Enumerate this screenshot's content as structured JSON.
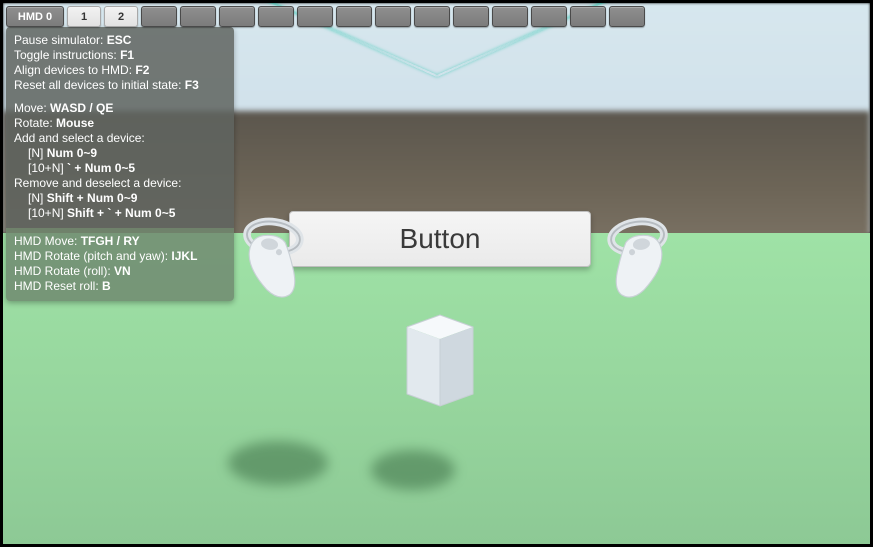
{
  "topbar": {
    "hmd_label": "HMD 0",
    "active_devices": [
      "1",
      "2"
    ],
    "blank_count": 13
  },
  "world_button_label": "Button",
  "instructions": {
    "group1": [
      {
        "label": "Pause simulator:",
        "key": "ESC"
      },
      {
        "label": "Toggle instructions:",
        "key": "F1"
      },
      {
        "label": "Align devices to HMD:",
        "key": "F2"
      },
      {
        "label": "Reset all devices to initial state:",
        "key": "F3"
      }
    ],
    "group2": {
      "move": {
        "label": "Move:",
        "key": "WASD / QE"
      },
      "rotate": {
        "label": "Rotate:",
        "key": "Mouse"
      },
      "add_header": "Add and select a device:",
      "add_n": {
        "prefix": "[N]",
        "key": "Num 0~9"
      },
      "add_10n": {
        "prefix": "[10+N]",
        "key": "` + Num 0~5"
      },
      "remove_header": "Remove and deselect a device:",
      "rem_n": {
        "prefix": "[N]",
        "key": "Shift + Num 0~9"
      },
      "rem_10n": {
        "prefix": "[10+N]",
        "key": "Shift + ` + Num 0~5"
      }
    },
    "group3": [
      {
        "label": "HMD Move:",
        "key": "TFGH / RY"
      },
      {
        "label": "HMD Rotate (pitch and yaw):",
        "key": "IJKL"
      },
      {
        "label": "HMD Rotate (roll):",
        "key": "VN"
      },
      {
        "label": "HMD Reset roll:",
        "key": "B"
      }
    ]
  }
}
